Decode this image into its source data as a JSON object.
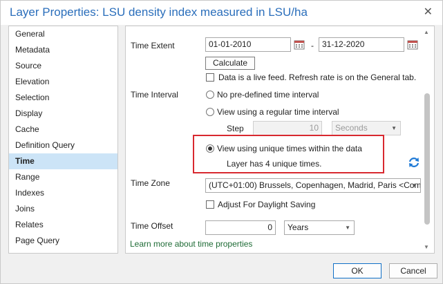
{
  "title": "Layer Properties: LSU density index measured in LSU/ha",
  "sidebar": {
    "items": [
      {
        "label": "General"
      },
      {
        "label": "Metadata"
      },
      {
        "label": "Source"
      },
      {
        "label": "Elevation"
      },
      {
        "label": "Selection"
      },
      {
        "label": "Display"
      },
      {
        "label": "Cache"
      },
      {
        "label": "Definition Query"
      },
      {
        "label": "Time",
        "active": true
      },
      {
        "label": "Range"
      },
      {
        "label": "Indexes"
      },
      {
        "label": "Joins"
      },
      {
        "label": "Relates"
      },
      {
        "label": "Page Query"
      }
    ]
  },
  "time_extent": {
    "label": "Time Extent",
    "start": "01-01-2010",
    "separator": "-",
    "end": "31-12-2020",
    "calculate_label": "Calculate",
    "live_feed_label": "Data is a live feed. Refresh rate is on the General tab."
  },
  "time_interval": {
    "label": "Time Interval",
    "no_predefined": "No pre-defined time interval",
    "regular": "View using a regular time interval",
    "step_label": "Step",
    "step_value": "10",
    "step_unit": "Seconds",
    "unique": "View using unique times within the data",
    "unique_info": "Layer has 4 unique times."
  },
  "time_zone": {
    "label": "Time Zone",
    "value": "(UTC+01:00) Brussels, Copenhagen, Madrid, Paris <Com",
    "daylight_label": "Adjust For Daylight Saving"
  },
  "time_offset": {
    "label": "Time Offset",
    "value": "0",
    "unit": "Years"
  },
  "learn_more": "Learn more about time properties",
  "footer": {
    "ok": "OK",
    "cancel": "Cancel"
  },
  "colors": {
    "title": "#2a6ebb",
    "highlight": "#d8282f",
    "active_item": "#cce4f7",
    "link": "#1e6b35"
  }
}
